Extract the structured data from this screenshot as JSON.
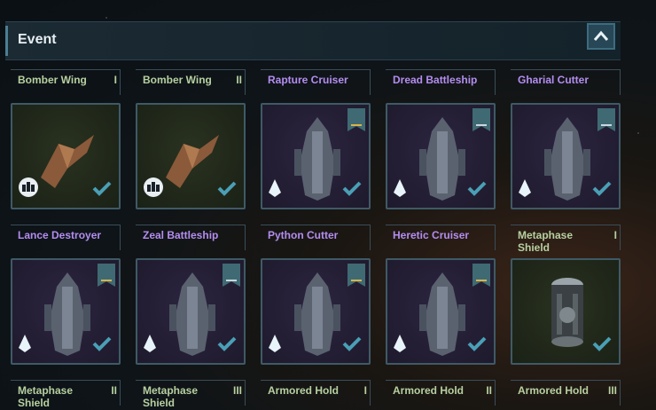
{
  "section": {
    "title": "Event"
  },
  "colors": {
    "green_name": "#b7d0a0",
    "purple_name": "#b48df0"
  },
  "items": [
    {
      "name": "Bomber Wing",
      "tier": "I",
      "rarity": "green",
      "icon": "fighter-squadron-icon",
      "banner": ""
    },
    {
      "name": "Bomber Wing",
      "tier": "II",
      "rarity": "green",
      "icon": "fighter-squadron-icon",
      "banner": ""
    },
    {
      "name": "Rapture Cruiser",
      "tier": "",
      "rarity": "purple",
      "icon": "crystal-icon",
      "banner": "gold"
    },
    {
      "name": "Dread Battleship",
      "tier": "",
      "rarity": "purple",
      "icon": "crystal-icon",
      "banner": "silver"
    },
    {
      "name": "Gharial Cutter",
      "tier": "",
      "rarity": "purple",
      "icon": "crystal-icon",
      "banner": "silver"
    },
    {
      "name": "Lance Destroyer",
      "tier": "",
      "rarity": "purple",
      "icon": "crystal-icon",
      "banner": "gold"
    },
    {
      "name": "Zeal Battleship",
      "tier": "",
      "rarity": "purple",
      "icon": "crystal-icon",
      "banner": "silver"
    },
    {
      "name": "Python Cutter",
      "tier": "",
      "rarity": "purple",
      "icon": "crystal-icon",
      "banner": "gold"
    },
    {
      "name": "Heretic Cruiser",
      "tier": "",
      "rarity": "purple",
      "icon": "crystal-icon",
      "banner": "gold"
    },
    {
      "name": "Metaphase Shield",
      "tier": "I",
      "rarity": "green",
      "icon": "",
      "banner": ""
    },
    {
      "name": "Metaphase Shield",
      "tier": "II",
      "rarity": "green",
      "icon": "",
      "banner": ""
    },
    {
      "name": "Metaphase Shield",
      "tier": "III",
      "rarity": "green",
      "icon": "",
      "banner": ""
    },
    {
      "name": "Armored Hold",
      "tier": "I",
      "rarity": "green",
      "icon": "",
      "banner": ""
    },
    {
      "name": "Armored Hold",
      "tier": "II",
      "rarity": "green",
      "icon": "",
      "banner": ""
    },
    {
      "name": "Armored Hold",
      "tier": "III",
      "rarity": "green",
      "icon": "",
      "banner": ""
    }
  ]
}
